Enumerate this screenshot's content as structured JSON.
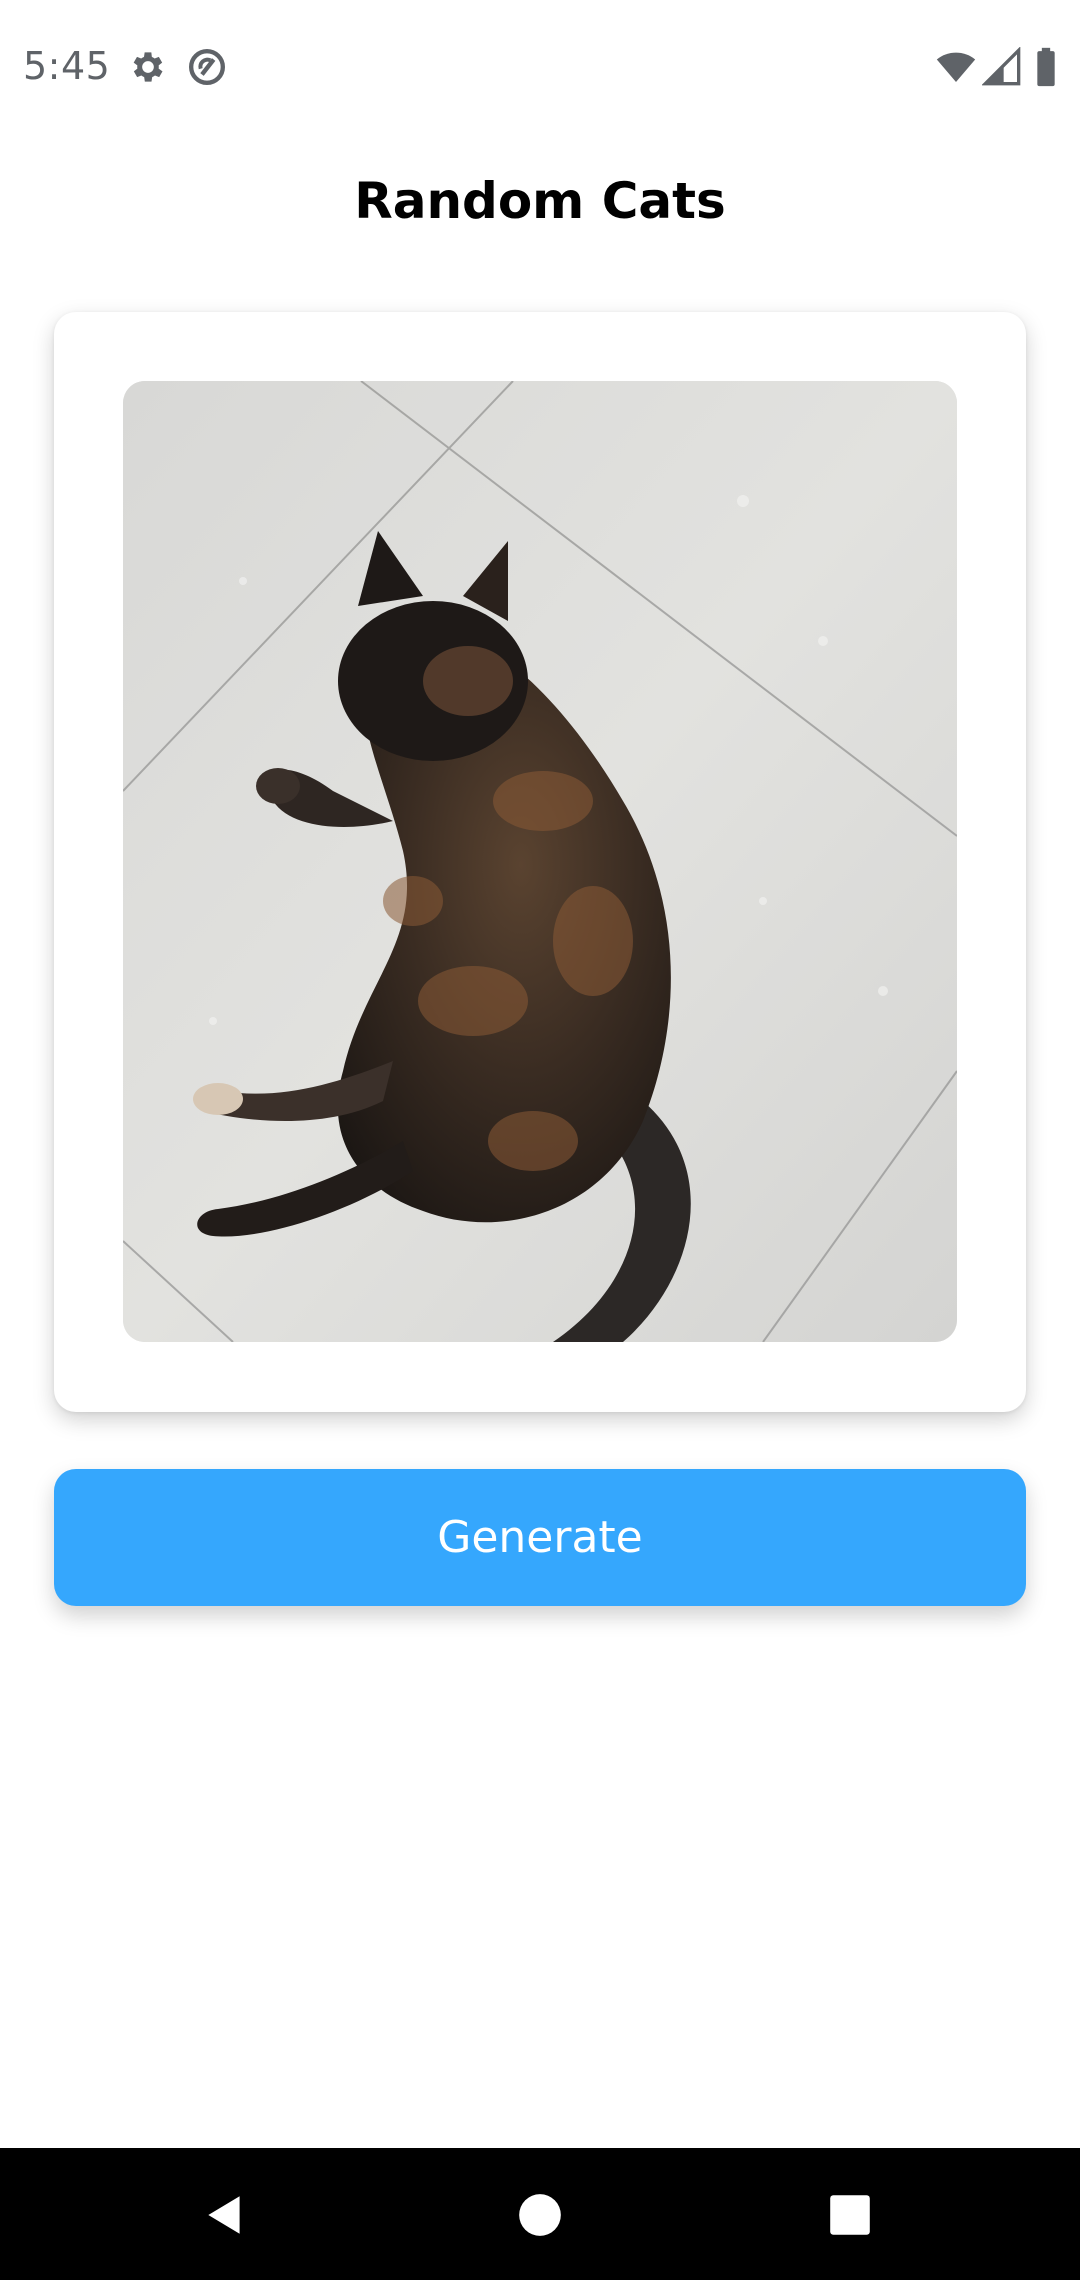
{
  "status_bar": {
    "time": "5:45",
    "icons": [
      "gear-icon",
      "no-sync-icon",
      "wifi-icon",
      "cell-signal-icon",
      "battery-icon"
    ]
  },
  "header": {
    "title": "Random Cats"
  },
  "card": {
    "image": "cat-photo"
  },
  "actions": {
    "generate_label": "Generate"
  },
  "nav_bar": {
    "icons": [
      "back-icon",
      "home-icon",
      "recents-icon"
    ]
  },
  "colors": {
    "accent": "#35a7fd",
    "background": "#ffffff",
    "nav_background": "#000000",
    "status_text": "#5f6368"
  }
}
